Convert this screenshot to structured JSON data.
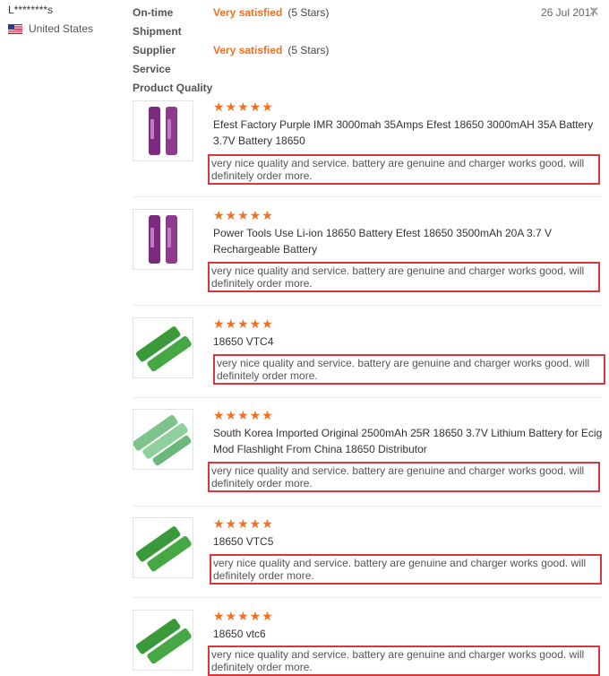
{
  "reviewer": {
    "name": "L********s",
    "country": "United States"
  },
  "date": "26 Jul 2017",
  "ratings": [
    {
      "label_line1": "On-time",
      "label_line2": "Shipment",
      "satisfaction": "Very satisfied",
      "stars_text": "(5 Stars)"
    },
    {
      "label_line1": "Supplier",
      "label_line2": "Service",
      "satisfaction": "Very satisfied",
      "stars_text": "(5 Stars)"
    }
  ],
  "product_quality_label": "Product Quality",
  "reviews": [
    {
      "stars": "★★★★★",
      "title": "Efest Factory Purple IMR 3000mah 35Amps Efest 18650 3000mAH 35A Battery 3.7V Battery 18650",
      "comment": "very nice quality and service. battery are genuine and charger works good. will definitely order more.",
      "thumb": "purple"
    },
    {
      "stars": "★★★★★",
      "title": "Power Tools Use Li-ion 18650 Battery Efest 18650 3500mAh 20A 3.7 V Rechargeable Battery",
      "comment": "very nice quality and service. battery are genuine and charger works good. will definitely order more.",
      "thumb": "purple"
    },
    {
      "stars": "★★★★★",
      "title": "18650 VTC4",
      "comment": "very nice quality and service. battery are genuine and charger works good. will definitely order more.",
      "thumb": "green"
    },
    {
      "stars": "★★★★★",
      "title": "South Korea Imported Original 2500mAh 25R 18650 3.7V Lithium Battery for Ecig Mod Flashlight From China 18650 Distributor",
      "comment": "very nice quality and service. battery are genuine and charger works good. will definitely order more.",
      "thumb": "lightgreen"
    },
    {
      "stars": "★★★★★",
      "title": "18650 VTC5",
      "comment": "very nice quality and service. battery are genuine and charger works good. will definitely order more.",
      "thumb": "green"
    },
    {
      "stars": "★★★★★",
      "title": "18650 vtc6",
      "comment": "very nice quality and service. battery are genuine and charger works good. will definitely order more.",
      "thumb": "green"
    }
  ]
}
